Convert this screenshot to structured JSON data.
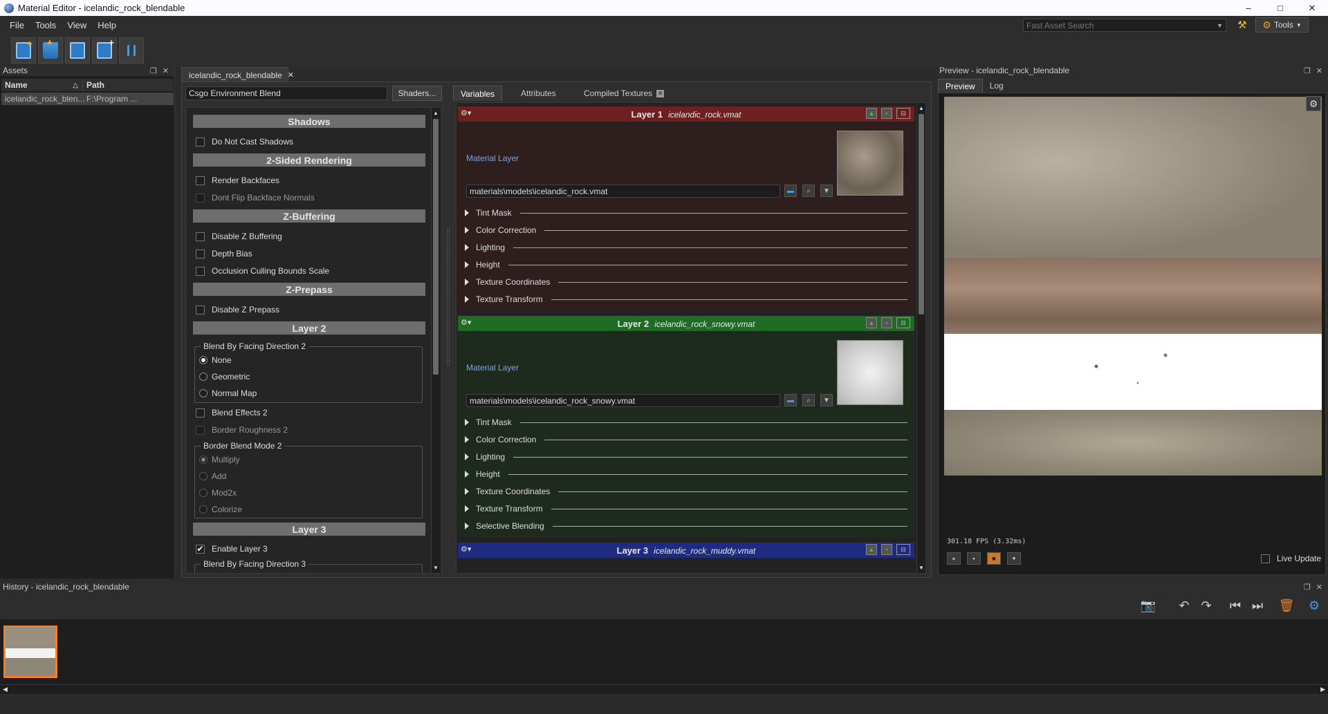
{
  "window": {
    "title": "Material Editor - icelandic_rock_blendable",
    "min": "–",
    "max": "□",
    "close": "✕"
  },
  "menu": [
    "File",
    "Tools",
    "View",
    "Help"
  ],
  "search": {
    "placeholder": "Fast Asset Search"
  },
  "tools_label": "Tools",
  "assets": {
    "title": "Assets",
    "col_name": "Name",
    "col_path": "Path",
    "rows": [
      {
        "name": "icelandic_rock_blen...",
        "path": "F:\\Program ..."
      }
    ]
  },
  "editor": {
    "tab_label": "icelandic_rock_blendable",
    "shader": "Csgo Environment Blend",
    "shaders_button": "Shaders...",
    "sections": {
      "shadows": "Shadows",
      "two_sided": "2-Sided Rendering",
      "zbuffering": "Z-Buffering",
      "zprepass": "Z-Prepass",
      "layer2": "Layer 2",
      "layer3": "Layer 3"
    },
    "options": {
      "do_not_cast_shadows": "Do Not Cast Shadows",
      "render_backfaces": "Render Backfaces",
      "dont_flip_backface_normals": "Dont Flip Backface Normals",
      "disable_z_buffering": "Disable Z Buffering",
      "depth_bias": "Depth Bias",
      "occlusion_culling": "Occlusion Culling Bounds Scale",
      "disable_z_prepass": "Disable Z Prepass",
      "blend_by_facing_2": "Blend By Facing Direction 2",
      "none": "None",
      "geometric": "Geometric",
      "normal_map": "Normal Map",
      "blend_effects_2": "Blend Effects 2",
      "border_roughness_2": "Border Roughness 2",
      "border_blend_mode_2": "Border Blend Mode 2",
      "multiply": "Multiply",
      "add": "Add",
      "mod2x": "Mod2x",
      "colorize": "Colorize",
      "enable_layer_3": "Enable Layer 3",
      "blend_by_facing_3": "Blend By Facing Direction 3"
    }
  },
  "tabs": {
    "variables": "Variables",
    "attributes": "Attributes",
    "compiled_textures": "Compiled Textures"
  },
  "layers": [
    {
      "label": "Layer 1",
      "file": "icelandic_rock.vmat",
      "material_label": "Material Layer",
      "path": "materials\\models\\icelandic_rock.vmat",
      "head_color": "#6e2020",
      "body_color": "#2e1e1e",
      "groups": [
        "Tint Mask",
        "Color Correction",
        "Lighting",
        "Height",
        "Texture Coordinates",
        "Texture Transform"
      ]
    },
    {
      "label": "Layer 2",
      "file": "icelandic_rock_snowy.vmat",
      "material_label": "Material Layer",
      "path": "materials\\models\\icelandic_rock_snowy.vmat",
      "head_color": "#1f6b24",
      "body_color": "#1e2a1e",
      "groups": [
        "Tint Mask",
        "Color Correction",
        "Lighting",
        "Height",
        "Texture Coordinates",
        "Texture Transform",
        "Selective Blending"
      ]
    },
    {
      "label": "Layer 3",
      "file": "icelandic_rock_muddy.vmat",
      "head_color": "#1f2b80"
    }
  ],
  "preview": {
    "title": "Preview - icelandic_rock_blendable",
    "tab_preview": "Preview",
    "tab_log": "Log",
    "fps": "301.18 FPS (3.32ms)",
    "live_update": "Live Update"
  },
  "history": {
    "title": "History - icelandic_rock_blendable"
  }
}
